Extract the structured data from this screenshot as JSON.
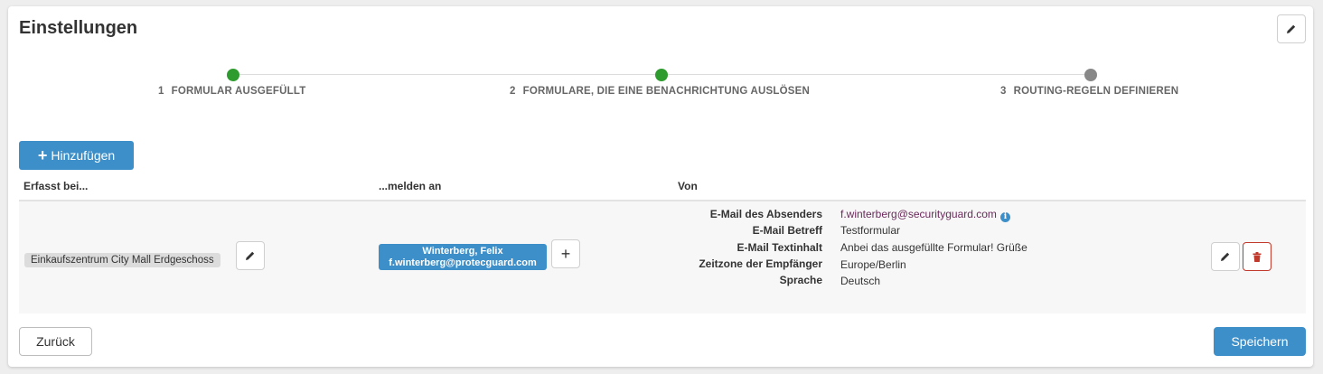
{
  "page": {
    "title": "Einstellungen"
  },
  "colors": {
    "primary": "#3d8fc9",
    "step_done": "#2e9b2e",
    "step_todo": "#888888",
    "danger": "#c0392b"
  },
  "steps": [
    {
      "num": "1",
      "label": "FORMULAR AUSGEFÜLLT",
      "status": "done"
    },
    {
      "num": "2",
      "label": "FORMULARE, DIE EINE BENACHRICHTUNG AUSLÖSEN",
      "status": "done"
    },
    {
      "num": "3",
      "label": "ROUTING-REGELN DEFINIEREN",
      "status": "current"
    }
  ],
  "toolbar": {
    "add_label": "Hinzufügen"
  },
  "table": {
    "headers": {
      "captured_at": "Erfasst bei...",
      "notify_to": "...melden an",
      "from": "Von"
    },
    "row": {
      "location": "Einkaufszentrum City Mall Erdgeschoss",
      "recipient": {
        "name": "Winterberg, Felix",
        "email": "f.winterberg@protecguard.com"
      },
      "details": [
        {
          "label": "E-Mail des Absenders",
          "value": "f.winterberg@securityguard.com"
        },
        {
          "label": "E-Mail Betreff",
          "value": "Testformular"
        },
        {
          "label": "E-Mail Textinhalt",
          "value": "Anbei das ausgefüllte Formular! Grüße"
        },
        {
          "label": "Zeitzone der Empfänger",
          "value": "Europe/Berlin"
        },
        {
          "label": "Sprache",
          "value": "Deutsch"
        }
      ]
    }
  },
  "footer": {
    "back_label": "Zurück",
    "save_label": "Speichern"
  },
  "icons": {
    "edit": "pencil-icon",
    "delete": "trash-icon",
    "add": "plus-icon",
    "info": "info-icon"
  }
}
